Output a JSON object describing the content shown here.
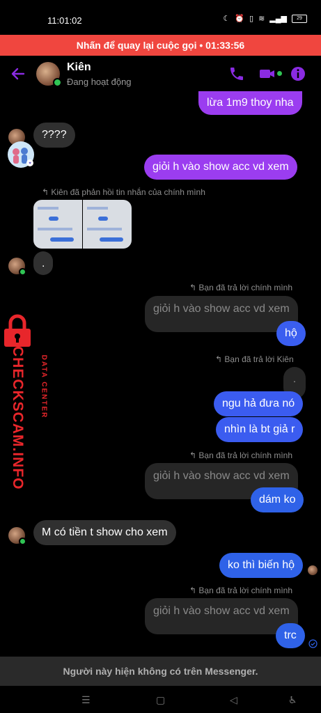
{
  "status_bar": {
    "time": "11:01:02",
    "battery": "29"
  },
  "call_banner": {
    "text": "Nhấn để quay lại cuộc gọi • 01:33:56"
  },
  "header": {
    "name": "Kiên",
    "status": "Đang hoạt động"
  },
  "colors": {
    "accent": "#8a2be2",
    "call_banner": "#f0463f",
    "out_top": "#9b3df0",
    "out_bottom": "#2f62e8",
    "online": "#30c454"
  },
  "messages": {
    "m1": "lừa 1m9 thoy nha",
    "m2": "????",
    "m3": "giỏi h vào show acc vd xem",
    "sys1": "Kiên đã phản hồi tin nhắn của chính mình",
    "m4": ".",
    "sys2": "Bạn đã trả lời chính mình",
    "q1": "giỏi h vào show acc vd xem",
    "m5": "hộ",
    "sys3": "Bạn đã trả lời Kiên",
    "q2": ".",
    "m6": "ngu hả đưa nó",
    "m7": "nhìn là bt giả r",
    "sys4": "Bạn đã trả lời chính mình",
    "q3": "giỏi h vào show acc vd xem",
    "m8": "dám ko",
    "m9": "M có tiền t show cho xem",
    "m10": "ko thì biến hộ",
    "sys5": "Bạn đã trả lời chính mình",
    "q4": "giỏi h vào show acc vd xem",
    "m11": "trc"
  },
  "watermark": {
    "brand": "CHECKSCAM.INFO",
    "tag": "DATA CENTER"
  },
  "footer": {
    "notice": "Người này hiện không có trên Messenger."
  },
  "icons": [
    "back-arrow-icon",
    "phone-icon",
    "video-icon",
    "info-icon",
    "reply-arrow-icon",
    "menu-icon",
    "home-icon",
    "back-icon",
    "accessibility-icon",
    "read-check-icon"
  ]
}
